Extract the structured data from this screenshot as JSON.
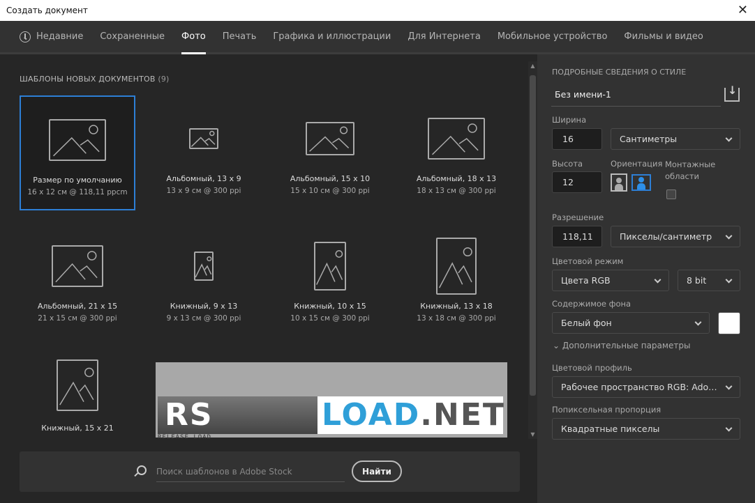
{
  "window": {
    "title": "Создать документ"
  },
  "tabs": [
    {
      "label": "Недавние"
    },
    {
      "label": "Сохраненные"
    },
    {
      "label": "Фото"
    },
    {
      "label": "Печать"
    },
    {
      "label": "Графика и иллюстрации"
    },
    {
      "label": "Для Интернета"
    },
    {
      "label": "Мобильное устройство"
    },
    {
      "label": "Фильмы и видео"
    }
  ],
  "templates": {
    "heading": "ШАБЛОНЫ НОВЫХ ДОКУМЕНТОВ",
    "count": "(9)",
    "items": [
      {
        "name": "Размер по умолчанию",
        "sub": "16 x 12 см @ 118,11 ppcm"
      },
      {
        "name": "Альбомный, 13 x 9",
        "sub": "13 x 9 см @ 300 ppi"
      },
      {
        "name": "Альбомный, 15 x 10",
        "sub": "15 x 10 см @ 300 ppi"
      },
      {
        "name": "Альбомный, 18 x 13",
        "sub": "18 x 13 см @ 300 ppi"
      },
      {
        "name": "Альбомный, 21 x 15",
        "sub": "21 x 15 см @ 300 ppi"
      },
      {
        "name": "Книжный, 9 x 13",
        "sub": "9 x 13 см @ 300 ppi"
      },
      {
        "name": "Книжный, 10 x 15",
        "sub": "10 x 15 см @ 300 ppi"
      },
      {
        "name": "Книжный, 13 x 18",
        "sub": "13 x 18 см @ 300 ppi"
      },
      {
        "name": "Книжный, 15 x 21",
        "sub": ""
      }
    ]
  },
  "watermark": {
    "rs": "RS",
    "load": "LOAD",
    "net": ".NET",
    "tagline": "RELEASE LOAD"
  },
  "search": {
    "placeholder": "Поиск шаблонов в Adobe Stock",
    "button": "Найти"
  },
  "details": {
    "heading": "ПОДРОБНЫЕ СВЕДЕНИЯ О СТИЛЕ",
    "name": "Без имени-1",
    "width_label": "Ширина",
    "width": "16",
    "width_unit": "Сантиметры",
    "height_label": "Высота",
    "height": "12",
    "orientation_label": "Ориентация",
    "artboards_label": "Монтажные области",
    "resolution_label": "Разрешение",
    "resolution": "118,11",
    "resolution_unit": "Пикселы/сантиметр",
    "color_mode_label": "Цветовой режим",
    "color_mode": "Цвета RGB",
    "bit_depth": "8 bit",
    "background_label": "Содержимое фона",
    "background": "Белый фон",
    "background_color": "#ffffff",
    "advanced": "Дополнительные параметры",
    "profile_label": "Цветовой профиль",
    "profile": "Рабочее пространство RGB: Adobe...",
    "pixel_aspect_label": "Попиксельная пропорция",
    "pixel_aspect": "Квадратные пикселы"
  },
  "colors": {
    "accent": "#2d7fd6",
    "panel": "#323232",
    "bg": "#262626"
  }
}
